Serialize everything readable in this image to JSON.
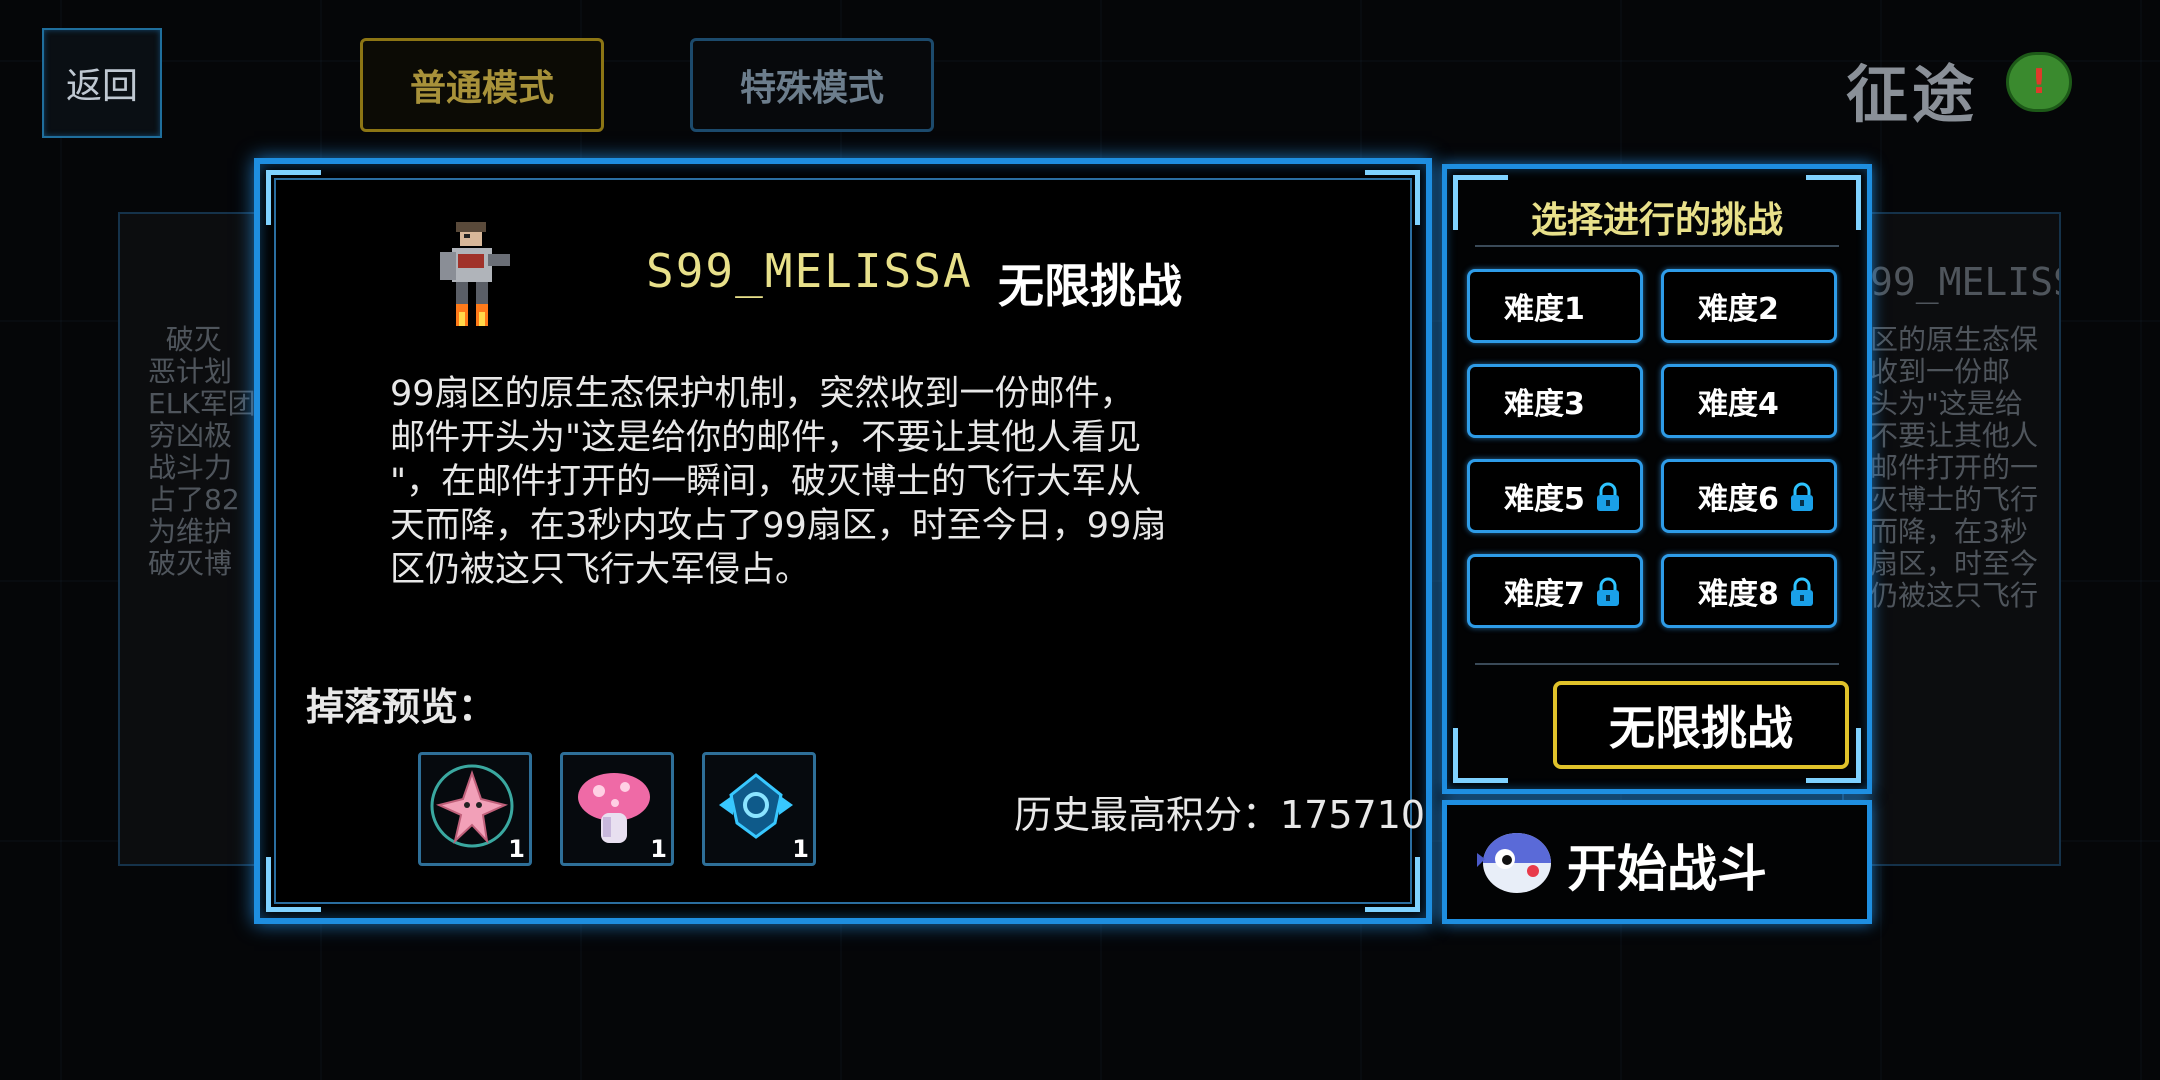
{
  "top_bar": {
    "back_label": "返回",
    "mode_normal": "普通模式",
    "mode_special": "特殊模式",
    "journey_label": "征途",
    "journey_badge": "!"
  },
  "side_left": {
    "lines": [
      "  破灭",
      "恶计划",
      "ELK军团",
      "穷凶极",
      "战斗力",
      "占了82",
      "为维护",
      "破灭博"
    ]
  },
  "side_right": {
    "title": "99_MELISS",
    "lines": [
      "区的原生态保",
      "收到一份邮",
      "头为\"这是给",
      "不要让其他人",
      "邮件打开的一",
      "灭博士的飞行",
      "而降，在3秒",
      "扇区，时至今",
      "仍被这只飞行"
    ]
  },
  "main": {
    "boss_name": "S99_MELISSA",
    "mode_title": "无限挑战",
    "description": "  99扇区的原生态保护机制，突然收到一份邮件，\n邮件开头为\"这是给你的邮件，不要让其他人看见\n\"，在邮件打开的一瞬间，破灭博士的飞行大军从\n天而降，在3秒内攻占了99扇区，时至今日，99扇\n区仍被这只飞行大军侵占。",
    "drop_label": "掉落预览：",
    "drops": [
      {
        "icon": "pink-star-creature-icon",
        "count": "1"
      },
      {
        "icon": "pink-mushroom-icon",
        "count": "1"
      },
      {
        "icon": "blue-gem-icon",
        "count": "1"
      }
    ],
    "highscore": "历史最高积分：175710"
  },
  "challenge": {
    "title": "选择进行的挑战",
    "difficulties": [
      {
        "label": "难度1",
        "locked": false
      },
      {
        "label": "难度2",
        "locked": false
      },
      {
        "label": "难度3",
        "locked": false
      },
      {
        "label": "难度4",
        "locked": false
      },
      {
        "label": "难度5",
        "locked": true
      },
      {
        "label": "难度6",
        "locked": true
      },
      {
        "label": "难度7",
        "locked": true
      },
      {
        "label": "难度8",
        "locked": true
      }
    ],
    "infinite_label": "无限挑战"
  },
  "start": {
    "label": "开始战斗",
    "icon": "pufferfish-icon"
  },
  "colors": {
    "accent_blue": "#1e8ee0",
    "title_yellow": "#e8e08a",
    "highlight_gold": "#e0c22a"
  }
}
